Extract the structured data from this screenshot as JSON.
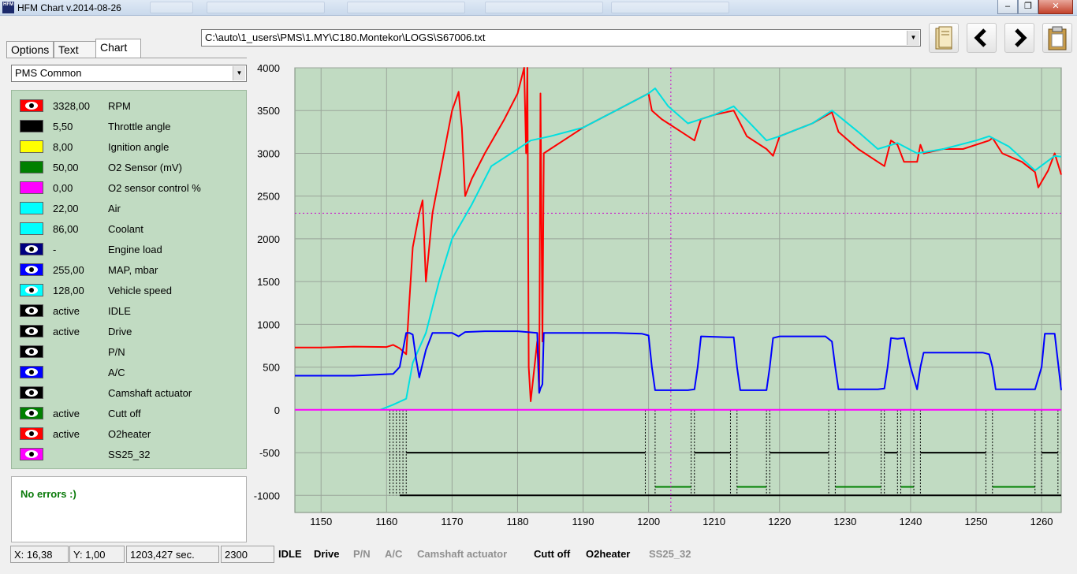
{
  "titlebar": {
    "app_icon_text": "HFM",
    "title": "HFM Chart   v.2014-08-26"
  },
  "tabs": [
    {
      "label": "Options",
      "active": false
    },
    {
      "label": "Text",
      "active": false
    },
    {
      "label": "Chart",
      "active": true
    }
  ],
  "file_path": "C:\\auto\\1_users\\PMS\\1.MY\\C180.Montekor\\LOGS\\S67006.txt",
  "toolbar": {
    "open_icon": "open-book-icon",
    "prev_icon": "arrow-left-icon",
    "next_icon": "arrow-right-icon",
    "paste_icon": "clipboard-icon"
  },
  "preset_select": "PMS Common",
  "channels": [
    {
      "value": "3328,00",
      "name": "RPM",
      "color": "#ff0000",
      "eye": true
    },
    {
      "value": "5,50",
      "name": "Throttle angle",
      "color": "#000000",
      "eye": false
    },
    {
      "value": "8,00",
      "name": "Ignition angle",
      "color": "#ffff00",
      "eye": false
    },
    {
      "value": "50,00",
      "name": "O2 Sensor (mV)",
      "color": "#008000",
      "eye": false
    },
    {
      "value": "0,00",
      "name": "O2 sensor control %",
      "color": "#ff00ff",
      "eye": false
    },
    {
      "value": "22,00",
      "name": "Air",
      "color": "#00ffff",
      "eye": false
    },
    {
      "value": "86,00",
      "name": "Coolant",
      "color": "#00ffff",
      "eye": false
    },
    {
      "value": "-",
      "name": "Engine load",
      "color": "#000080",
      "eye": true
    },
    {
      "value": "255,00",
      "name": "MAP, mbar",
      "color": "#0000ff",
      "eye": true
    },
    {
      "value": "128,00",
      "name": "Vehicle speed",
      "color": "#00ffff",
      "eye": true
    },
    {
      "value": "active",
      "name": "IDLE",
      "color": "#000000",
      "eye": true
    },
    {
      "value": "active",
      "name": "Drive",
      "color": "#000000",
      "eye": true
    },
    {
      "value": "",
      "name": "P/N",
      "color": "#000000",
      "eye": true
    },
    {
      "value": "",
      "name": "A/C",
      "color": "#0000ff",
      "eye": true
    },
    {
      "value": "",
      "name": "Camshaft actuator",
      "color": "#000000",
      "eye": true
    },
    {
      "value": "active",
      "name": "Cutt off",
      "color": "#008000",
      "eye": true
    },
    {
      "value": "active",
      "name": "O2heater",
      "color": "#ff0000",
      "eye": true
    },
    {
      "value": "",
      "name": "SS25_32",
      "color": "#ff00ff",
      "eye": true
    }
  ],
  "errors_text": "No errors :)",
  "status": {
    "x": "X: 16,38",
    "y": "Y: 1,00",
    "time": "1203,427 sec.",
    "value": "2300",
    "flags": [
      {
        "label": "IDLE",
        "active": true
      },
      {
        "label": "Drive",
        "active": true
      },
      {
        "label": "P/N",
        "active": false
      },
      {
        "label": "A/C",
        "active": false
      },
      {
        "label": "Camshaft actuator",
        "active": false
      },
      {
        "label": "Cutt off",
        "active": true
      },
      {
        "label": "O2heater",
        "active": true
      },
      {
        "label": "SS25_32",
        "active": false
      }
    ]
  },
  "chart_data": {
    "type": "line",
    "xlim": [
      1146,
      1263
    ],
    "ylim": [
      -1200,
      4000
    ],
    "x_ticks": [
      1150,
      1160,
      1170,
      1180,
      1190,
      1200,
      1210,
      1220,
      1230,
      1240,
      1250,
      1260
    ],
    "y_ticks": [
      4000,
      3500,
      3000,
      2500,
      2000,
      1500,
      1000,
      500,
      0,
      -500,
      -1000
    ],
    "background": "#c1dbc2",
    "grid": true,
    "cursor": {
      "x": 1203.4,
      "y": 2300
    },
    "series": [
      {
        "name": "RPM",
        "color": "#ff0000",
        "x": [
          1146,
          1150,
          1155,
          1160,
          1161,
          1162,
          1163,
          1163.5,
          1164,
          1165,
          1165.5,
          1166,
          1167,
          1168,
          1169,
          1170,
          1171,
          1171.5,
          1172,
          1173,
          1175,
          1178,
          1180,
          1181,
          1181.3,
          1181.5,
          1181.7,
          1182,
          1183,
          1183.3,
          1183.5,
          1183.8,
          1184,
          1185,
          1187,
          1190,
          1195,
          1200,
          1200.5,
          1202,
          1205,
          1207,
          1208,
          1210,
          1213,
          1215,
          1217,
          1218,
          1219,
          1220,
          1225,
          1228,
          1229,
          1232,
          1235,
          1236,
          1237,
          1238,
          1239,
          1241,
          1241.5,
          1242,
          1245,
          1248,
          1252,
          1252.5,
          1254,
          1257,
          1259,
          1259.5,
          1261,
          1262,
          1263
        ],
        "y": [
          730,
          730,
          740,
          735,
          760,
          720,
          650,
          1300,
          1900,
          2300,
          2450,
          1500,
          2300,
          2700,
          3100,
          3500,
          3720,
          3300,
          2500,
          2700,
          3000,
          3400,
          3700,
          4000,
          3000,
          4000,
          500,
          100,
          800,
          200,
          3700,
          800,
          3000,
          3050,
          3150,
          3300,
          3500,
          3700,
          3500,
          3400,
          3250,
          3150,
          3400,
          3450,
          3500,
          3200,
          3100,
          3050,
          2970,
          3200,
          3350,
          3480,
          3250,
          3050,
          2900,
          2850,
          3150,
          3100,
          2900,
          2900,
          3100,
          3000,
          3050,
          3050,
          3150,
          3180,
          3000,
          2900,
          2780,
          2600,
          2800,
          3000,
          2750
        ]
      },
      {
        "name": "Vehicle speed",
        "color": "#00e0e0",
        "x": [
          1159,
          1161,
          1163,
          1164,
          1166,
          1168,
          1170,
          1173,
          1176,
          1179,
          1182,
          1185,
          1190,
          1195,
          1200,
          1201,
          1203,
          1206,
          1210,
          1213,
          1218,
          1220,
          1225,
          1228,
          1232,
          1235,
          1238,
          1241,
          1245,
          1250,
          1252,
          1255,
          1259,
          1262,
          1263
        ],
        "y": [
          0,
          60,
          130,
          550,
          900,
          1500,
          2000,
          2400,
          2850,
          3000,
          3150,
          3200,
          3300,
          3500,
          3700,
          3760,
          3550,
          3350,
          3450,
          3550,
          3150,
          3200,
          3350,
          3500,
          3250,
          3050,
          3120,
          3000,
          3050,
          3150,
          3200,
          3080,
          2800,
          2970,
          2960
        ]
      },
      {
        "name": "MAP, mbar",
        "color": "#0000ff",
        "x": [
          1146,
          1155,
          1161,
          1162,
          1163,
          1163.5,
          1164,
          1164.5,
          1165,
          1166,
          1167,
          1170,
          1171,
          1172,
          1175,
          1180,
          1183,
          1183.3,
          1183.5,
          1183.8,
          1184,
          1185,
          1190,
          1195,
          1199,
          1200,
          1200.5,
          1201,
          1206,
          1207,
          1207.5,
          1208,
          1212,
          1213,
          1213.5,
          1214,
          1217,
          1218,
          1218.5,
          1219,
          1220,
          1227,
          1228,
          1228.5,
          1229,
          1235,
          1236,
          1236.5,
          1237,
          1238,
          1239,
          1240,
          1241,
          1241.5,
          1242,
          1245,
          1251,
          1252,
          1252.5,
          1253,
          1259,
          1260,
          1260.5,
          1261,
          1262,
          1263
        ],
        "y": [
          400,
          400,
          420,
          500,
          900,
          900,
          880,
          600,
          380,
          700,
          900,
          900,
          860,
          910,
          920,
          920,
          900,
          200,
          250,
          300,
          900,
          900,
          900,
          900,
          890,
          870,
          500,
          230,
          230,
          240,
          500,
          860,
          850,
          850,
          500,
          230,
          230,
          230,
          500,
          840,
          860,
          860,
          800,
          500,
          240,
          240,
          250,
          500,
          840,
          830,
          840,
          500,
          240,
          500,
          670,
          670,
          670,
          650,
          500,
          240,
          240,
          500,
          890,
          890,
          890,
          230
        ]
      },
      {
        "name": "O2 sensor control %",
        "color": "#ff00ff",
        "x": [
          1146,
          1263
        ],
        "y": [
          0,
          0
        ]
      }
    ]
  }
}
